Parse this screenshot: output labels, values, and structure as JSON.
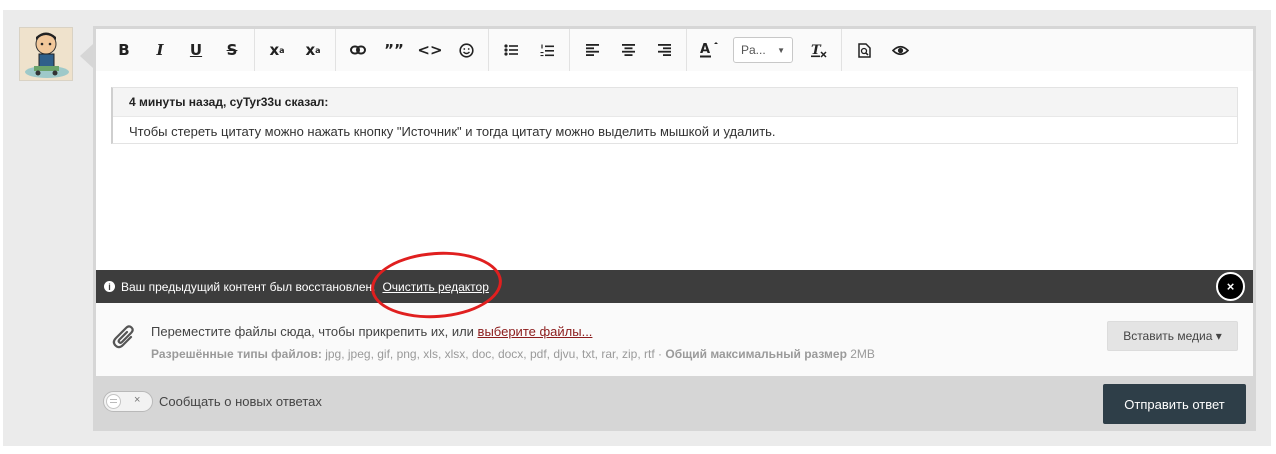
{
  "toolbar": {
    "buttons": {
      "bold": "B",
      "italic": "I",
      "underline": "U",
      "strike": "S",
      "subscript": "x",
      "sub_small": "a",
      "superscript": "x",
      "sup_small": "a",
      "quote": "””",
      "code": "<>"
    },
    "font_size_value": "Pa...",
    "accent_color": "#222222"
  },
  "quote": {
    "header": "4 минуты назад, cyTyr33u сказал:",
    "body": "Чтобы стереть цитату можно нажать кнопку \"Источник\" и тогда цитату можно выделить мышкой и удалить."
  },
  "restore_bar": {
    "message": "Ваш предыдущий контент был восстановлен.",
    "link": "Очистить редактор",
    "close": "×"
  },
  "attach": {
    "prompt": "Переместите файлы сюда, чтобы прикрепить их, или ",
    "choose_link": "выберите файлы...",
    "types_label": "Разрешённые типы файлов:",
    "types": " jpg, jpeg, gif, png, xls, xlsx, doc, docx, pdf, djvu, txt, rar, zip, rtf · ",
    "max_label": "Общий максимальный размер",
    "max_value": " 2MB",
    "media_button": "Вставить медиа ▾"
  },
  "footer": {
    "toggle_x": "×",
    "notify_label": "Сообщать о новых ответах",
    "submit": "Отправить ответ"
  },
  "colors": {
    "submit_bg": "#2e3e48",
    "restore_bar_bg": "#3d3d3d",
    "highlight_circle": "#e01f1f",
    "link_red": "#8b1b1b"
  }
}
